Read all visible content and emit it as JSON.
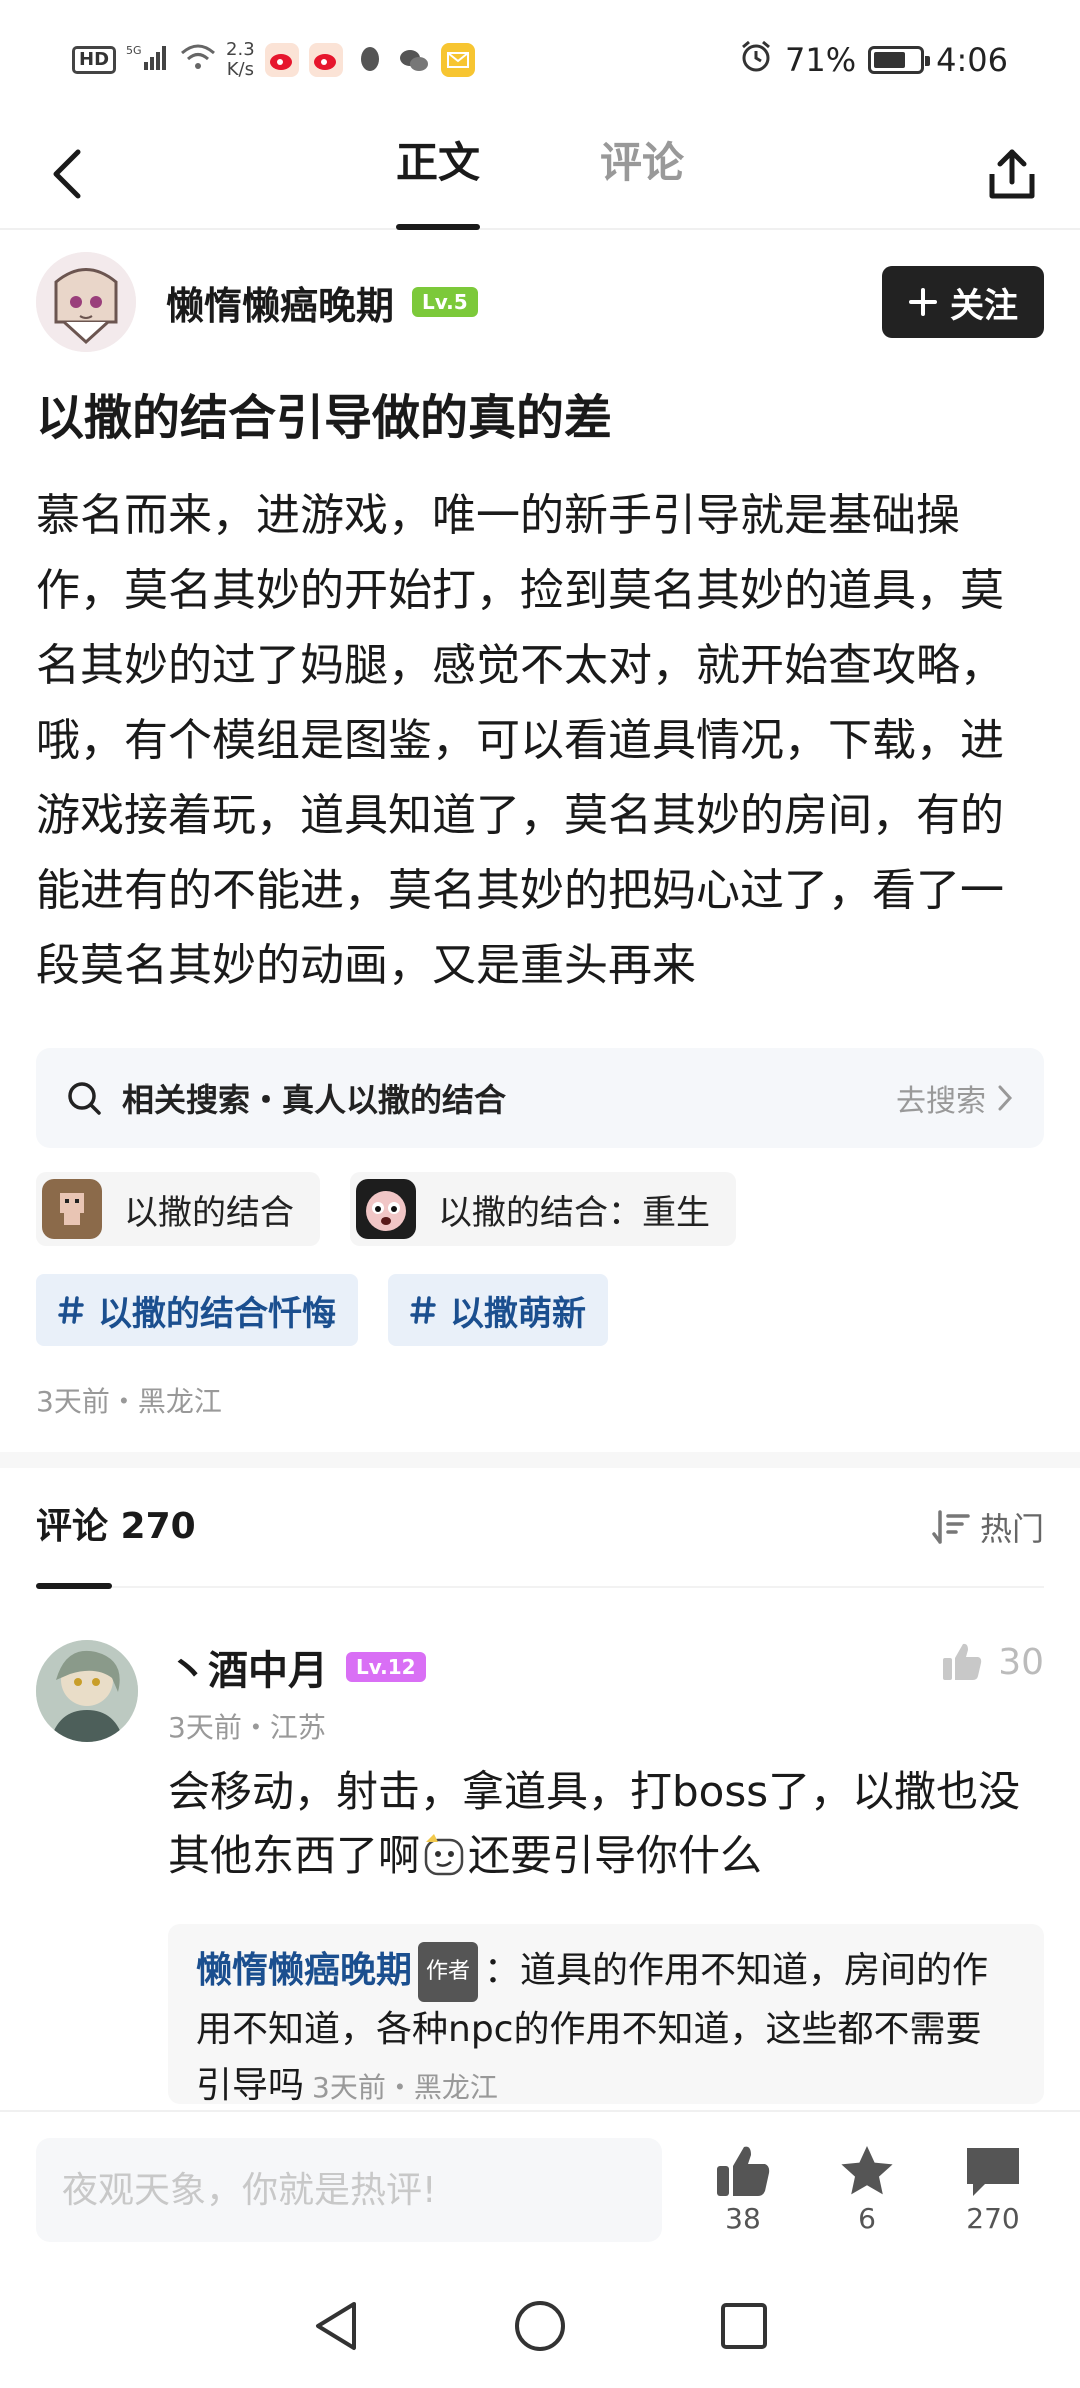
{
  "status_bar": {
    "hd": "HD",
    "signal": "5G",
    "net_speed_value": "2.3",
    "net_speed_unit": "K/s",
    "battery": "71%",
    "battery_level": 0.71,
    "time": "4:06"
  },
  "nav": {
    "tabs": [
      {
        "label": "正文",
        "active": true
      },
      {
        "label": "评论",
        "active": false
      }
    ]
  },
  "author": {
    "name": "懒惰懒癌晚期",
    "level": "Lv.5",
    "follow_label": "关注"
  },
  "post": {
    "title": "以撒的结合引导做的真的差",
    "body": "慕名而来，进游戏，唯一的新手引导就是基础操作，莫名其妙的开始打，捡到莫名其妙的道具，莫名其妙的过了妈腿，感觉不太对，就开始查攻略，哦，有个模组是图鉴，可以看道具情况，下载，进游戏接着玩，道具知道了，莫名其妙的房间，有的能进有的不能进，莫名其妙的把妈心过了，看了一段莫名其妙的动画，又是重头再来",
    "related_search": "相关搜索・真人以撒的结合",
    "go_search": "去搜索",
    "game_tags": [
      "以撒的结合",
      "以撒的结合：重生"
    ],
    "topic_tags": [
      "以撒的结合忏悔",
      "以撒萌新"
    ],
    "meta": "3天前・黑龙江"
  },
  "comments": {
    "title": "评论 270",
    "sort_label": "热门",
    "items": [
      {
        "user": "丶酒中月",
        "level": "Lv.12",
        "likes": "30",
        "meta": "3天前・江苏",
        "text_before_emoji": "会移动，射击，拿道具，打boss了，以撒也没其他东西了啊",
        "text_after_emoji": "还要引导你什么",
        "reply": {
          "user": "懒惰懒癌晚期",
          "badge": "作者",
          "text": "：道具的作用不知道，房间的作用不知道，各种npc的作用不知道，这些都不需要引导吗",
          "meta": "3天前・黑龙江"
        }
      }
    ]
  },
  "bottom": {
    "input_placeholder": "夜观天象，你就是热评!",
    "likes": "38",
    "favorites": "6",
    "comments": "270"
  },
  "colors": {
    "accent_blue": "#1b4f8f",
    "lv5": "#7cc93a",
    "lv12": "#d96ff5"
  }
}
